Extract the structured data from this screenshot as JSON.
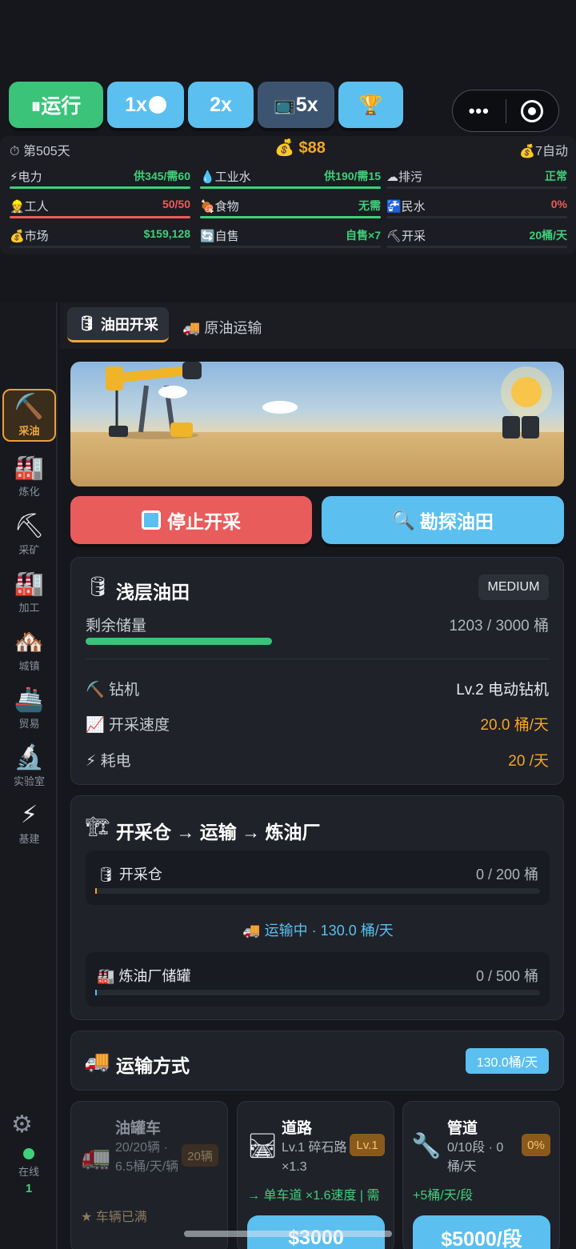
{
  "top_controls": {
    "run_label": "⏸运行",
    "speed_1x": "1x",
    "speed_2x": "2x",
    "speed_5x": "5x",
    "tv_icon": "tv-icon",
    "trophy_icon": "trophy-icon",
    "menu_dots": "•••"
  },
  "status": {
    "day": "第505天",
    "money": "$88",
    "auto": "7自动",
    "stats": [
      {
        "label": "⚡电力",
        "value": "供345/需60",
        "color": "#3fd07a",
        "fill": 1.0,
        "fill_color": "#3fd07a"
      },
      {
        "label": "💧工业水",
        "value": "供190/需15",
        "color": "#3fd07a",
        "fill": 1.0,
        "fill_color": "#3fd07a"
      },
      {
        "label": "☁排污",
        "value": "正常",
        "color": "#3fd07a",
        "fill": 0,
        "fill_color": "#3fd07a"
      },
      {
        "label": "👷工人",
        "value": "50/50",
        "color": "#ef5a5a",
        "fill": 1.0,
        "fill_color": "#ef5a5a"
      },
      {
        "label": "🍖食物",
        "value": "无需",
        "color": "#3fd07a",
        "fill": 1.0,
        "fill_color": "#3fd07a"
      },
      {
        "label": "🚰民水",
        "value": "0%",
        "color": "#ef5a5a",
        "fill": 0,
        "fill_color": "#ef5a5a"
      },
      {
        "label": "💰市场",
        "value": "$159,128",
        "color": "#3fd07a",
        "fill": 0,
        "fill_color": "#3fd07a"
      },
      {
        "label": "🔄自售",
        "value": "自售×7",
        "color": "#3fd07a",
        "fill": 0,
        "fill_color": "#3fd07a"
      },
      {
        "label": "⛏开采",
        "value": "20桶/天",
        "color": "#3fd07a",
        "fill": 0,
        "fill_color": "#3fd07a"
      }
    ]
  },
  "sidebar": {
    "items": [
      {
        "icon": "⛏️",
        "label": "采油"
      },
      {
        "icon": "🏭",
        "label": "炼化"
      },
      {
        "icon": "⛏",
        "label": "采矿"
      },
      {
        "icon": "🏭",
        "label": "加工"
      },
      {
        "icon": "🏘️",
        "label": "城镇"
      },
      {
        "icon": "🚢",
        "label": "贸易"
      },
      {
        "icon": "🔬",
        "label": "实验室"
      },
      {
        "icon": "⚡",
        "label": "基建"
      }
    ],
    "online_label": "在线",
    "online_count": "1"
  },
  "tabs": {
    "active": "油田开采",
    "second": "🚚 原油运输"
  },
  "actions": {
    "stop": "停止开采",
    "explore": "勘探油田"
  },
  "oilfield": {
    "name": "浅层油田",
    "size_badge": "MEDIUM",
    "reserve_label": "剩余储量",
    "reserve_value": "1203 / 3000 桶",
    "reserve_fraction": 0.401,
    "rig_label": "钻机",
    "rig_value": "Lv.2 电动钻机",
    "speed_label": "开采速度",
    "speed_value": "20.0 桶/天",
    "power_label": "耗电",
    "power_value": "20 /天"
  },
  "flow": {
    "title": "开采仓 → 运输 → 炼油厂",
    "silo_name": "开采仓",
    "silo_value": "0 / 200 桶",
    "transit": "🚚 运输中 · 130.0 桶/天",
    "tank_name": "炼油厂储罐",
    "tank_value": "0 / 500 桶"
  },
  "transport": {
    "title": "运输方式",
    "rate_badge": "130.0桶/天",
    "tanker": {
      "name": "油罐车",
      "detail": "20/20辆 · 6.5桶/天/辆",
      "badge": "20辆",
      "status": "★ 车辆已满"
    },
    "road": {
      "name": "道路",
      "detail": "Lv.1 碎石路 ×1.3",
      "badge": "Lv.1",
      "upgrade": "→ 单车道 ×1.6速度 | 需",
      "price": "$3000"
    },
    "pipe": {
      "name": "管道",
      "detail": "0/10段 · 0桶/天",
      "badge": "0%",
      "gain": "+5桶/天/段",
      "price": "$5000/段"
    }
  }
}
